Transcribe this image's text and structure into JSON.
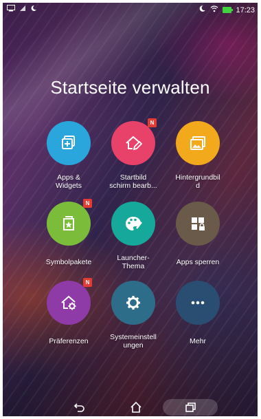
{
  "status_bar": {
    "time": "17:23",
    "left_icons": [
      "cast-icon",
      "signal-icon",
      "moon-icon"
    ],
    "right_icons": [
      "moon-icon",
      "wifi-icon",
      "battery-charging-icon"
    ]
  },
  "title": "Startseite verwalten",
  "tiles": [
    {
      "label": "Apps &\nWidgets",
      "icon": "apps-widgets-icon",
      "color": "#2ba6dc",
      "badge": ""
    },
    {
      "label": "Startbild\nschirm bearb...",
      "icon": "home-edit-icon",
      "color": "#e8416a",
      "badge": "N"
    },
    {
      "label": "Hintergrundbil\nd",
      "icon": "wallpaper-icon",
      "color": "#f2a91c",
      "badge": ""
    },
    {
      "label": "Symbolpakete",
      "icon": "icon-pack-icon",
      "color": "#7bbd3a",
      "badge": "N"
    },
    {
      "label": "Launcher-\nThema",
      "icon": "palette-icon",
      "color": "#16a89a",
      "badge": ""
    },
    {
      "label": "Apps sperren",
      "icon": "app-lock-icon",
      "color": "#6a5a4a",
      "badge": ""
    },
    {
      "label": "Präferenzen",
      "icon": "home-settings-icon",
      "color": "#8e3aa7",
      "badge": "N"
    },
    {
      "label": "Systemeinstell\nungen",
      "icon": "gear-icon",
      "color": "#2e6d8a",
      "badge": ""
    },
    {
      "label": "Mehr",
      "icon": "more-icon",
      "color": "#2a4e72",
      "badge": ""
    }
  ],
  "nav": {
    "back": "back-icon",
    "home": "home-icon",
    "recents": "recents-icon"
  }
}
